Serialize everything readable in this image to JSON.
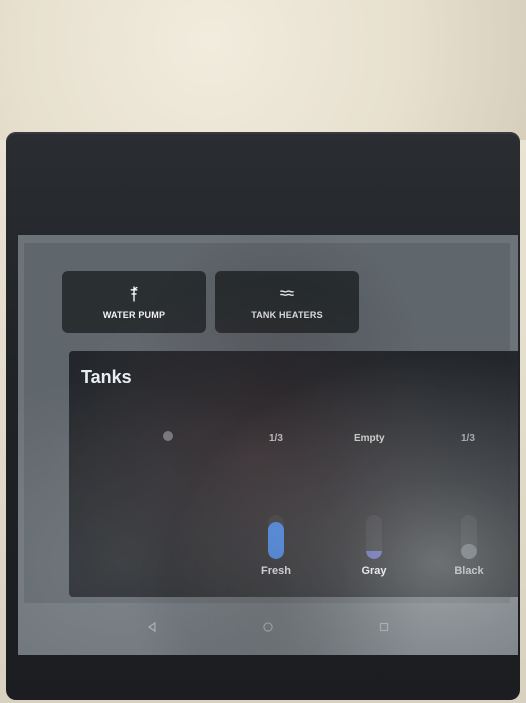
{
  "controls": {
    "water_pump": {
      "label": "WATER PUMP",
      "icon": "faucet-icon"
    },
    "tank_heaters": {
      "label": "TANK HEATERS",
      "icon": "heater-waves-icon"
    }
  },
  "tanks": {
    "title": "Tanks",
    "levels": {
      "fresh": "1/3",
      "gray": "Empty",
      "black": "1/3"
    },
    "items": [
      {
        "name": "Fresh",
        "fill_fraction": 0.85,
        "color": "#3d89f2"
      },
      {
        "name": "Gray",
        "fill_fraction": 0.18,
        "color": "#5e66b7"
      },
      {
        "name": "Black",
        "fill_fraction": 0.35,
        "color": "#7c8792"
      }
    ]
  },
  "nav": {
    "back_icon": "back-triangle-icon",
    "home_icon": "home-circle-icon",
    "recents_icon": "recents-square-icon"
  }
}
